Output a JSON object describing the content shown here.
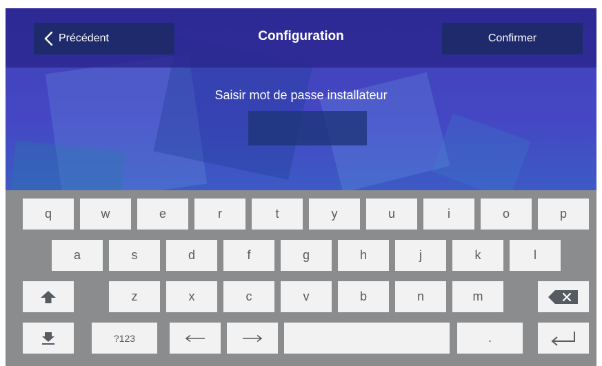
{
  "header": {
    "back_label": "Précédent",
    "title": "Configuration",
    "confirm_label": "Confirmer"
  },
  "form": {
    "prompt": "Saisir mot de passe installateur",
    "password_value": ""
  },
  "keyboard": {
    "row1": [
      "q",
      "w",
      "e",
      "r",
      "t",
      "y",
      "u",
      "i",
      "o",
      "p"
    ],
    "row2": [
      "a",
      "s",
      "d",
      "f",
      "g",
      "h",
      "j",
      "k",
      "l"
    ],
    "row3": [
      "z",
      "x",
      "c",
      "v",
      "b",
      "n",
      "m"
    ],
    "numbers_label": "?123",
    "period_label": "."
  },
  "colors": {
    "topbar": "#2a248c",
    "button": "#1f2a6d",
    "keyboard_bg": "#8b8c8e",
    "key_bg": "#f2f2f2",
    "key_text": "#555b60"
  },
  "icons": {
    "back": "chevron-left-icon",
    "shift": "shift-up-arrow-icon",
    "backspace": "backspace-x-icon",
    "hide_keyboard": "hide-keyboard-icon",
    "left": "arrow-left-icon",
    "right": "arrow-right-icon",
    "enter": "enter-return-icon"
  }
}
